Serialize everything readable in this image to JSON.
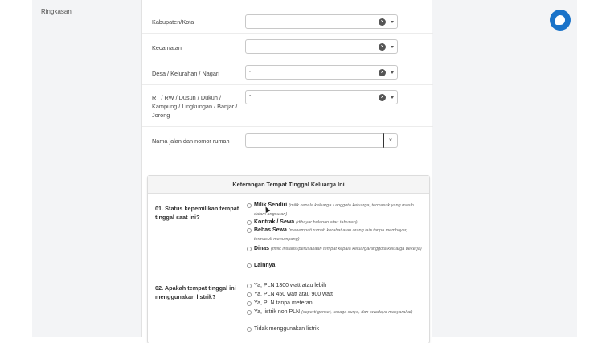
{
  "sidebar": {
    "summary_label": "Ringkasan"
  },
  "address_form": {
    "kabupaten": {
      "label": "Kabupaten/Kota",
      "value": ""
    },
    "kecamatan": {
      "label": "Kecamatan",
      "value": ""
    },
    "desa": {
      "label": "Desa / Kelurahan / Nagari",
      "value": "."
    },
    "rt_rw": {
      "label": "RT / RW / Dusun / Dukuh / Kampung / Lingkungan / Banjar / Jorong",
      "value": "-"
    },
    "street": {
      "label": "Nama jalan dan nomor rumah",
      "value": ""
    },
    "clear_symbol": "×",
    "clear_btn_symbol": "×"
  },
  "residence_card": {
    "title": "Keterangan Tempat Tinggal Keluarga Ini",
    "q1": {
      "label": "01. Status kepemilikan tempat tinggal saat ini?",
      "options": [
        {
          "main": "Milik Sendiri",
          "note": "(milik kepala keluarga / anggota keluarga, termasuk yang masih dalam angsuran)"
        },
        {
          "main": "Kontrak / Sewa",
          "note": "(dibayar bulanan atau tahunan)"
        },
        {
          "main": "Bebas Sewa",
          "note": "(menempati rumah kerabat atau orang lain tanpa membayar, termasuk menumpang)"
        },
        {
          "main": "Dinas",
          "note": "(milik instansi/perusahaan tempat kepala keluarga/anggota keluarga bekerja)"
        },
        {
          "main": "Lainnya",
          "note": ""
        }
      ]
    },
    "q2": {
      "label": "02. Apakah tempat tinggal ini menggunakan listrik?",
      "options": [
        {
          "main": "Ya, PLN 1300 watt atau lebih",
          "note": ""
        },
        {
          "main": "Ya, PLN 450 watt atau 900 watt",
          "note": ""
        },
        {
          "main": "Ya, PLN tanpa meteran",
          "note": ""
        },
        {
          "main": "Ya, listrik non PLN",
          "note": "(seperti genset, tenaga surya, dan swadaya masyarakat)"
        },
        {
          "main": "Tidak menggunakan listrik",
          "note": ""
        }
      ]
    }
  },
  "icons": {
    "chat": "chat-icon",
    "clear": "clear-icon",
    "dropdown": "chevron-down-icon",
    "cursor": "mouse-cursor-icon"
  },
  "colors": {
    "accent": "#1a73c9",
    "page_bg": "#f3f4f6"
  }
}
